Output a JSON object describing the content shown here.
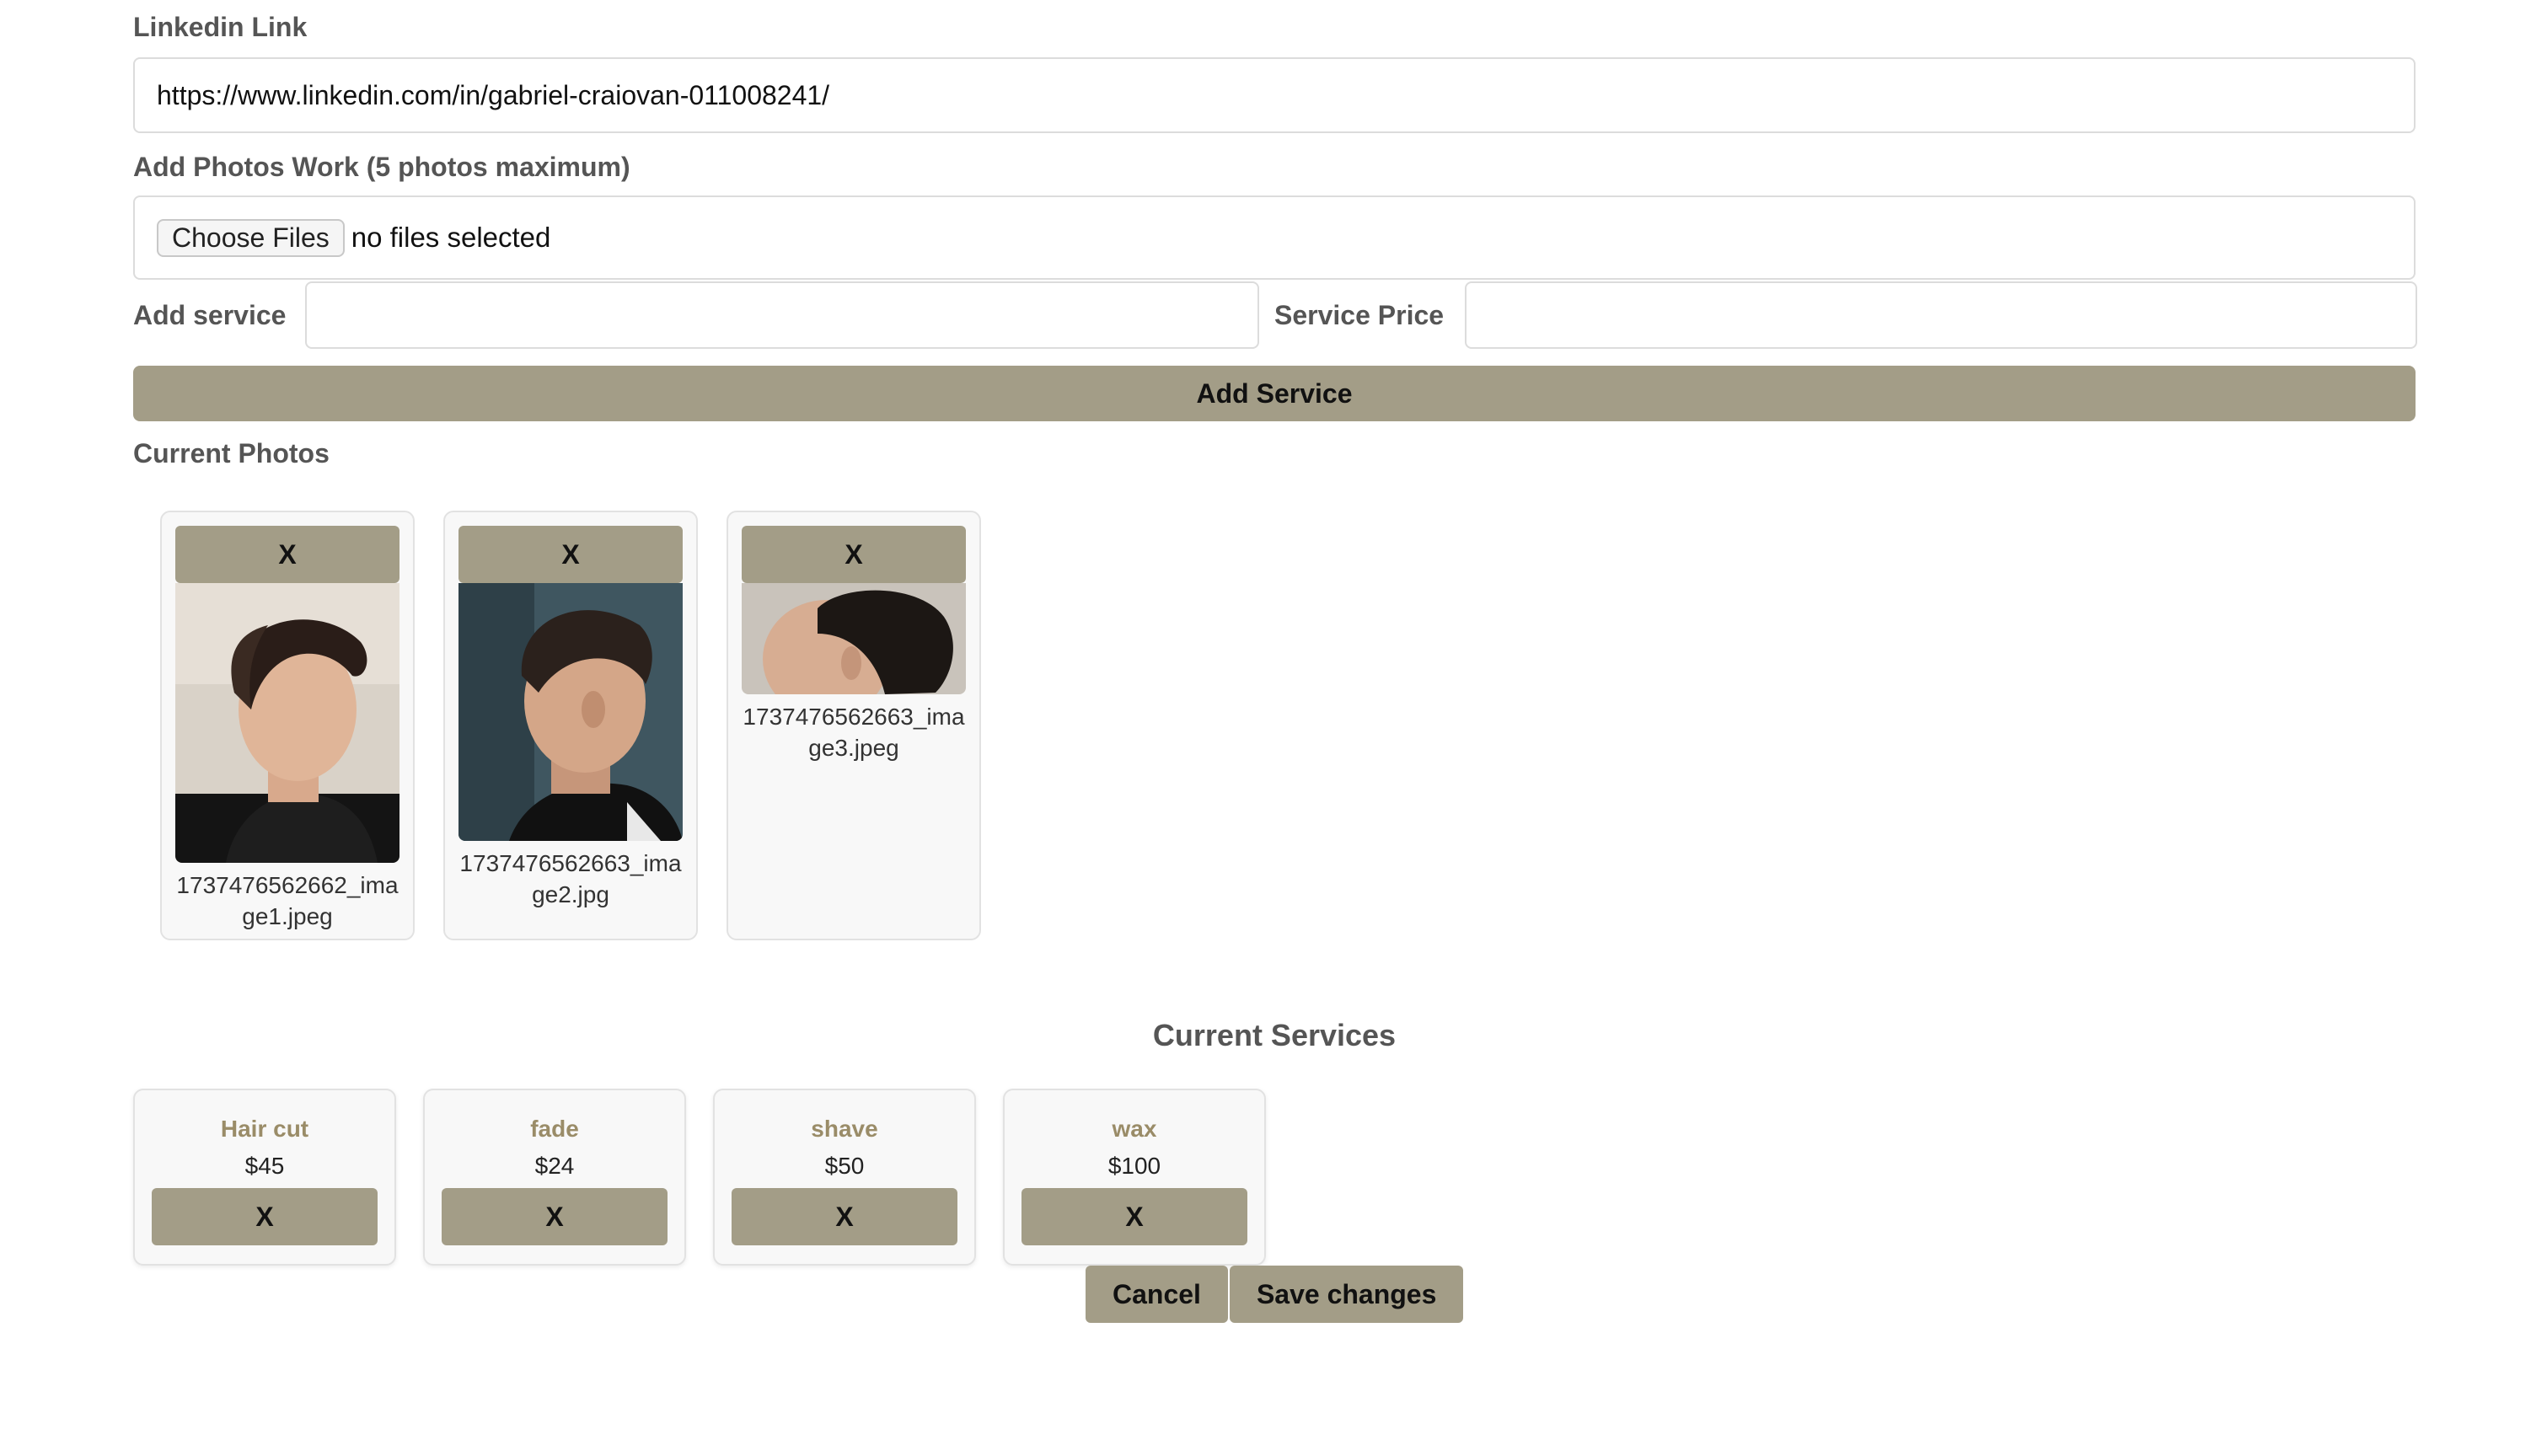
{
  "linkedin": {
    "label": "Linkedin Link",
    "value": "https://www.linkedin.com/in/gabriel-craiovan-011008241/"
  },
  "photos_upload": {
    "label": "Add Photos Work (5 photos maximum)",
    "choose_label": "Choose Files",
    "status": "no files selected"
  },
  "service_form": {
    "service_label": "Add service",
    "service_value": "",
    "price_label": "Service Price",
    "price_value": "",
    "add_button": "Add Service"
  },
  "current_photos": {
    "title": "Current Photos",
    "items": [
      {
        "remove_label": "X",
        "filename": "1737476562662_image1.jpeg",
        "icon": "photo-icon"
      },
      {
        "remove_label": "X",
        "filename": "1737476562663_image2.jpg",
        "icon": "photo-icon"
      },
      {
        "remove_label": "X",
        "filename": "1737476562663_image3.jpeg",
        "icon": "photo-icon"
      }
    ]
  },
  "current_services": {
    "title": "Current Services",
    "items": [
      {
        "name": "Hair cut",
        "price": "$45",
        "remove_label": "X"
      },
      {
        "name": "fade",
        "price": "$24",
        "remove_label": "X"
      },
      {
        "name": "shave",
        "price": "$50",
        "remove_label": "X"
      },
      {
        "name": "wax",
        "price": "$100",
        "remove_label": "X"
      }
    ]
  },
  "actions": {
    "cancel": "Cancel",
    "save": "Save changes"
  },
  "colors": {
    "accent": "#a39d87",
    "service_name": "#9a8c68",
    "label": "#555555"
  }
}
